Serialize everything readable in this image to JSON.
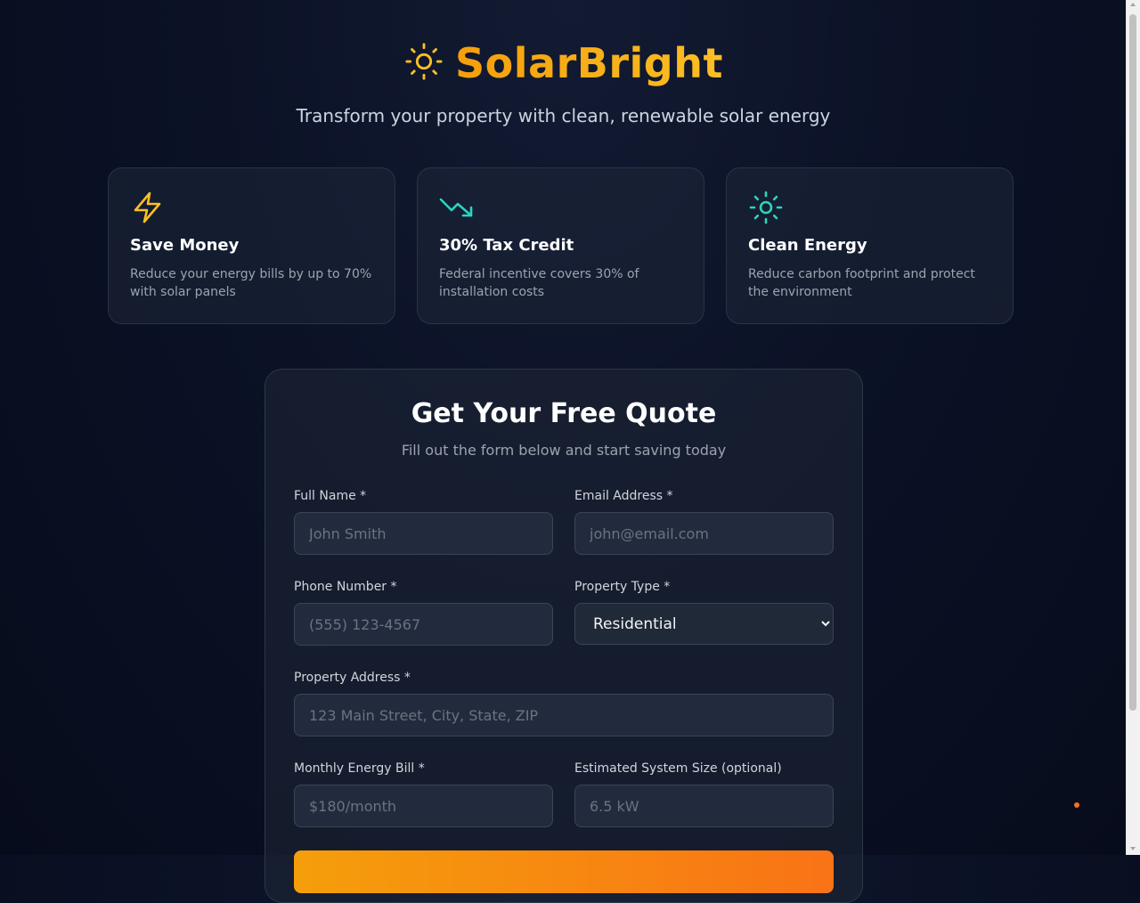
{
  "header": {
    "brand_name": "SolarBright",
    "tagline": "Transform your property with clean, renewable solar energy",
    "brand_icon": "sun-icon",
    "brand_color": "#fbbf24"
  },
  "features": [
    {
      "icon": "lightning-icon",
      "title": "Save Money",
      "desc": "Reduce your energy bills by up to 70% with solar panels",
      "color": "#fbbf24"
    },
    {
      "icon": "trending-down-icon",
      "title": "30% Tax Credit",
      "desc": "Federal incentive covers 30% of installation costs",
      "color": "#2dd4bf"
    },
    {
      "icon": "sun-icon",
      "title": "Clean Energy",
      "desc": "Reduce carbon footprint and protect the environment",
      "color": "#2dd4bf"
    }
  ],
  "form": {
    "title": "Get Your Free Quote",
    "subtitle": "Fill out the form below and start saving today",
    "full_name": {
      "label": "Full Name *",
      "placeholder": "John Smith",
      "value": ""
    },
    "email": {
      "label": "Email Address *",
      "placeholder": "john@email.com",
      "value": ""
    },
    "phone": {
      "label": "Phone Number *",
      "placeholder": "(555) 123-4567",
      "value": ""
    },
    "property_type": {
      "label": "Property Type *",
      "selected": "Residential"
    },
    "address": {
      "label": "Property Address *",
      "placeholder": "123 Main Street, City, State, ZIP",
      "value": ""
    },
    "bill": {
      "label": "Monthly Energy Bill *",
      "placeholder": "$180/month",
      "value": ""
    },
    "system_size": {
      "label": "Estimated System Size (optional)",
      "placeholder": "6.5 kW",
      "value": ""
    },
    "accent_color": "#f59e0b"
  }
}
